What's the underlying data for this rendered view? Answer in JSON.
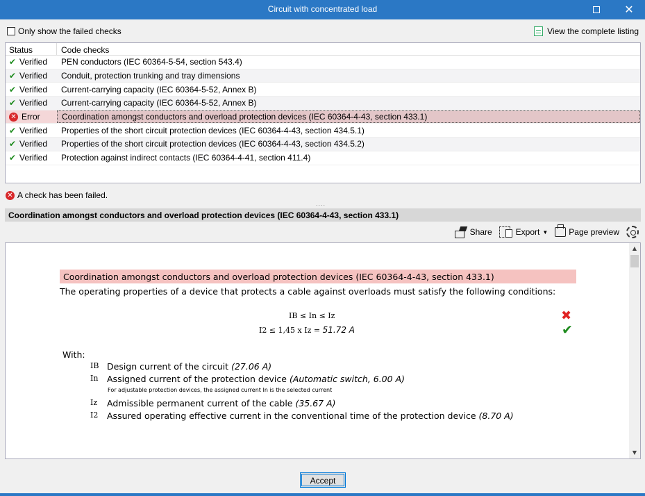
{
  "window": {
    "title": "Circuit with concentrated load"
  },
  "options": {
    "only_failed_label": "Only show the failed checks",
    "view_listing_label": "View the complete listing"
  },
  "checks": {
    "headers": {
      "status": "Status",
      "code": "Code checks"
    },
    "rows": [
      {
        "status": "Verified",
        "code": "PEN conductors (IEC 60364-5-54, section 543.4)"
      },
      {
        "status": "Verified",
        "code": "Conduit, protection trunking and tray dimensions"
      },
      {
        "status": "Verified",
        "code": "Current-carrying capacity (IEC 60364-5-52, Annex B)"
      },
      {
        "status": "Verified",
        "code": "Current-carrying capacity (IEC 60364-5-52, Annex B)"
      },
      {
        "status": "Error",
        "code": "Coordination amongst conductors and overload protection devices (IEC 60364-4-43, section 433.1)"
      },
      {
        "status": "Verified",
        "code": "Properties of the short circuit protection devices (IEC 60364-4-43, section 434.5.1)"
      },
      {
        "status": "Verified",
        "code": "Properties of the short circuit protection devices (IEC 60364-4-43, section 434.5.2)"
      },
      {
        "status": "Verified",
        "code": "Protection against indirect contacts (IEC 60364-4-41, section 411.4)"
      }
    ]
  },
  "fail_message": "A check has been failed.",
  "splitter_dots": "....",
  "section": {
    "title": "Coordination amongst conductors and overload protection devices (IEC 60364-4-43, section 433.1)"
  },
  "toolbar": {
    "share": "Share",
    "export": "Export",
    "page_preview": "Page preview"
  },
  "report": {
    "title": "Coordination amongst conductors and overload protection devices (IEC 60364-4-43, section 433.1)",
    "intro": "The operating properties of a device that protects a cable against overloads must satisfy the following conditions:",
    "formula1": "IB ≤ In ≤ Iz",
    "formula2_prefix": "I2 ≤ 1,45 x Iz = ",
    "formula2_value": "51.72 A",
    "with_label": "With:",
    "definitions": [
      {
        "symbol": "IB",
        "text": "Design current of the circuit ",
        "value": "(27.06 A)"
      },
      {
        "symbol": "In",
        "text": "Assigned current of the protection device ",
        "value": "(Automatic switch, 6.00 A)"
      },
      {
        "symbol": "Iz",
        "text": "Admissible permanent current of the cable ",
        "value": "(35.67 A)"
      },
      {
        "symbol": "I2",
        "text": "Assured operating effective current in the conventional time of the protection device ",
        "value": "(8.70 A)"
      }
    ],
    "note": "For adjustable protection devices, the assigned current In is the selected current"
  },
  "buttons": {
    "accept": "Accept"
  },
  "colors": {
    "titlebar": "#2b78c5",
    "error_row": "#f4d7d8",
    "report_title_bg": "#f5c2c0",
    "ok": "#1e8b1e",
    "fail": "#e02424"
  },
  "icons": [
    "maximize-icon",
    "close-icon",
    "listing-icon",
    "check-icon",
    "error-icon",
    "share-icon",
    "export-icon",
    "print-icon",
    "gear-icon",
    "cross-icon",
    "scroll-up-icon",
    "scroll-down-icon"
  ]
}
